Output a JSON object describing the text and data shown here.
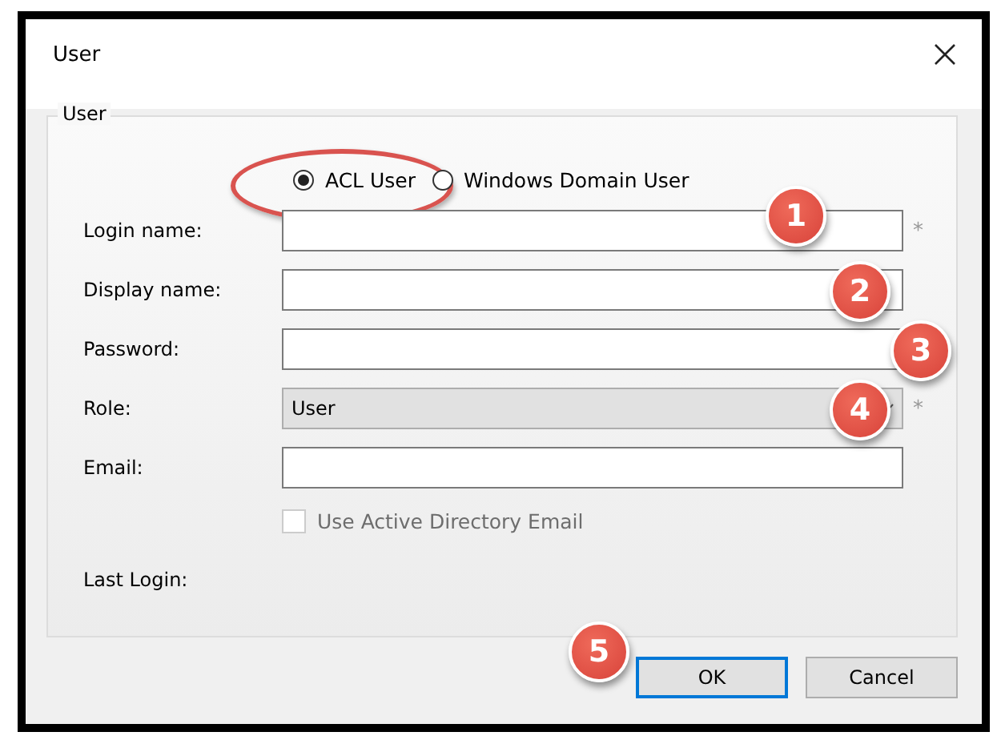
{
  "window": {
    "title": "User"
  },
  "group": {
    "title": "User"
  },
  "account_types": [
    {
      "label": "ACL User",
      "selected": true,
      "highlighted": true
    },
    {
      "label": "Windows Domain User",
      "selected": false,
      "highlighted": false
    }
  ],
  "fields": [
    {
      "kind": "text",
      "label": "Login name:",
      "required_mark": "*",
      "badge": "1"
    },
    {
      "kind": "text",
      "label": "Display name:",
      "badge": "2"
    },
    {
      "kind": "text",
      "label": "Password:",
      "badge": "3"
    },
    {
      "kind": "dropdown",
      "label": "Role:",
      "value": "User",
      "required_mark": "*",
      "badge": "4"
    },
    {
      "kind": "text",
      "label": "Email:"
    }
  ],
  "ad_email": {
    "label": "Use Active Directory Email",
    "checked": false,
    "disabled": true
  },
  "last_login": {
    "label": "Last Login:"
  },
  "buttons": [
    {
      "label": "OK",
      "default": true,
      "badge": "5"
    },
    {
      "label": "Cancel",
      "default": false
    }
  ]
}
